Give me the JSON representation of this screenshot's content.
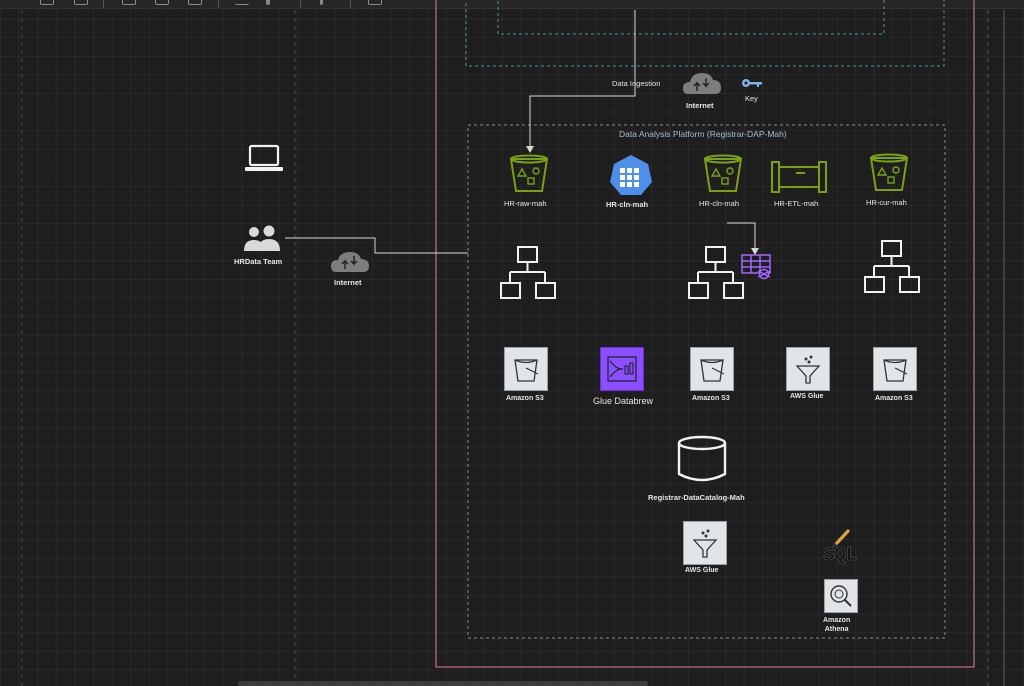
{
  "toolbar": {
    "icons": [
      "copy-icon",
      "duplicate-icon",
      "align-icon",
      "edit-style-icon",
      "paste-style-icon",
      "connector-icon",
      "waypoint-icon",
      "add-icon",
      "table-icon"
    ]
  },
  "diagram": {
    "platform_title": "Data Analysis Platform (Registrar-DAP-Mah)",
    "data_ingestion": "Data Ingestion",
    "internet_top": "Internet",
    "key": "Key",
    "hr_team": "HRData Team",
    "internet_left": "Internet",
    "buckets": [
      "HR-raw-mah",
      "HR-cln-mah",
      "HR-cln-mah",
      "HR-ETL-mah",
      "HR-cur-mah"
    ],
    "services": [
      "Amazon S3",
      "Glue Databrew",
      "Amazon S3",
      "AWS Glue",
      "Amazon S3"
    ],
    "catalog": "Registrar-DataCatalog-Mah",
    "glue_bottom": "AWS Glue",
    "sql": "SQL",
    "athena": "Amazon\nAthena"
  },
  "colors": {
    "background": "#1e1e1e",
    "pink_boundary": "#c56b8f",
    "teal_boundary": "#4a9e9e",
    "dashed_gray": "#8a8a8a",
    "s3_green": "#7aa116",
    "aws_blue": "#4d8fea",
    "databrew_purple": "#8c4fff"
  }
}
